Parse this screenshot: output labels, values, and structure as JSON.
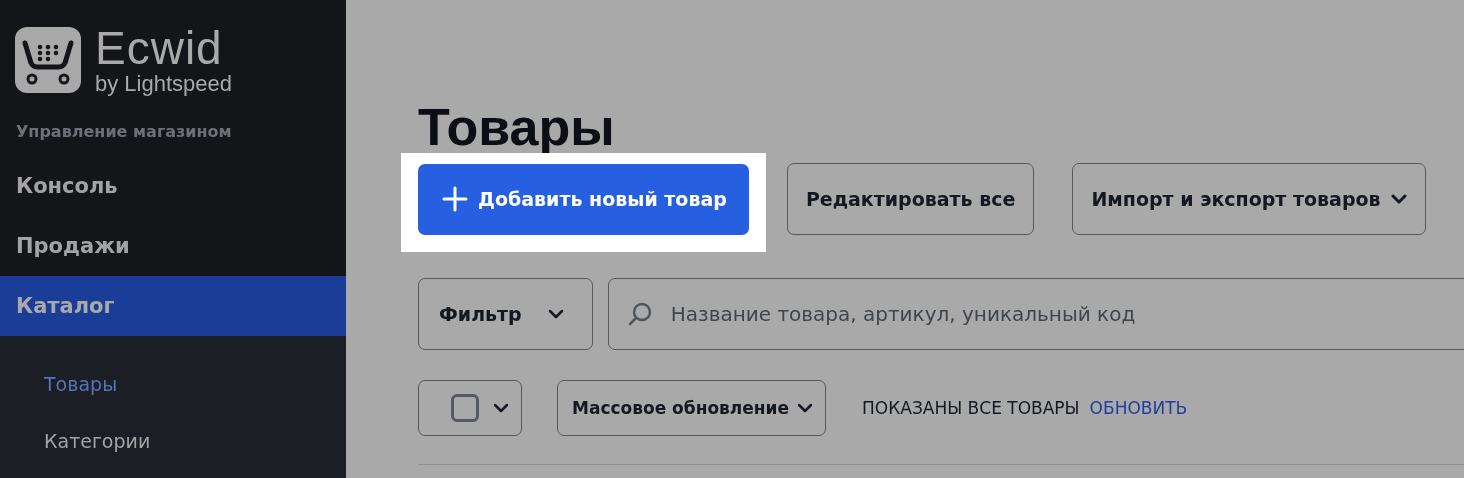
{
  "logo": {
    "name": "Ecwid",
    "tagline": "by Lightspeed"
  },
  "sidebar": {
    "section_title": "Управление магазином",
    "items": [
      {
        "label": "Консоль",
        "selected": false
      },
      {
        "label": "Продажи",
        "selected": false
      },
      {
        "label": "Каталог",
        "selected": true,
        "children": [
          {
            "label": "Товары",
            "selected": true
          },
          {
            "label": "Категории",
            "selected": false
          }
        ]
      }
    ]
  },
  "page": {
    "title": "Товары",
    "actions": [
      {
        "kind": "primary",
        "label": "Добавить новый товар",
        "highlighted": true
      },
      {
        "kind": "plain",
        "label": "Редактировать все",
        "highlighted": false
      },
      {
        "kind": "dropdown",
        "label": "Импорт и экспорт товаров",
        "highlighted": false
      }
    ],
    "filter": {
      "label": "Фильтр"
    },
    "search": {
      "placeholder": "Название товара, артикул, уникальный код"
    },
    "select_all": {
      "checked": false
    },
    "bulk_update": {
      "label": "Массовое обновление"
    },
    "status": "ПОКАЗАНЫ ВСЕ ТОВАРЫ",
    "refresh_link": "ОБНОВИТЬ"
  }
}
